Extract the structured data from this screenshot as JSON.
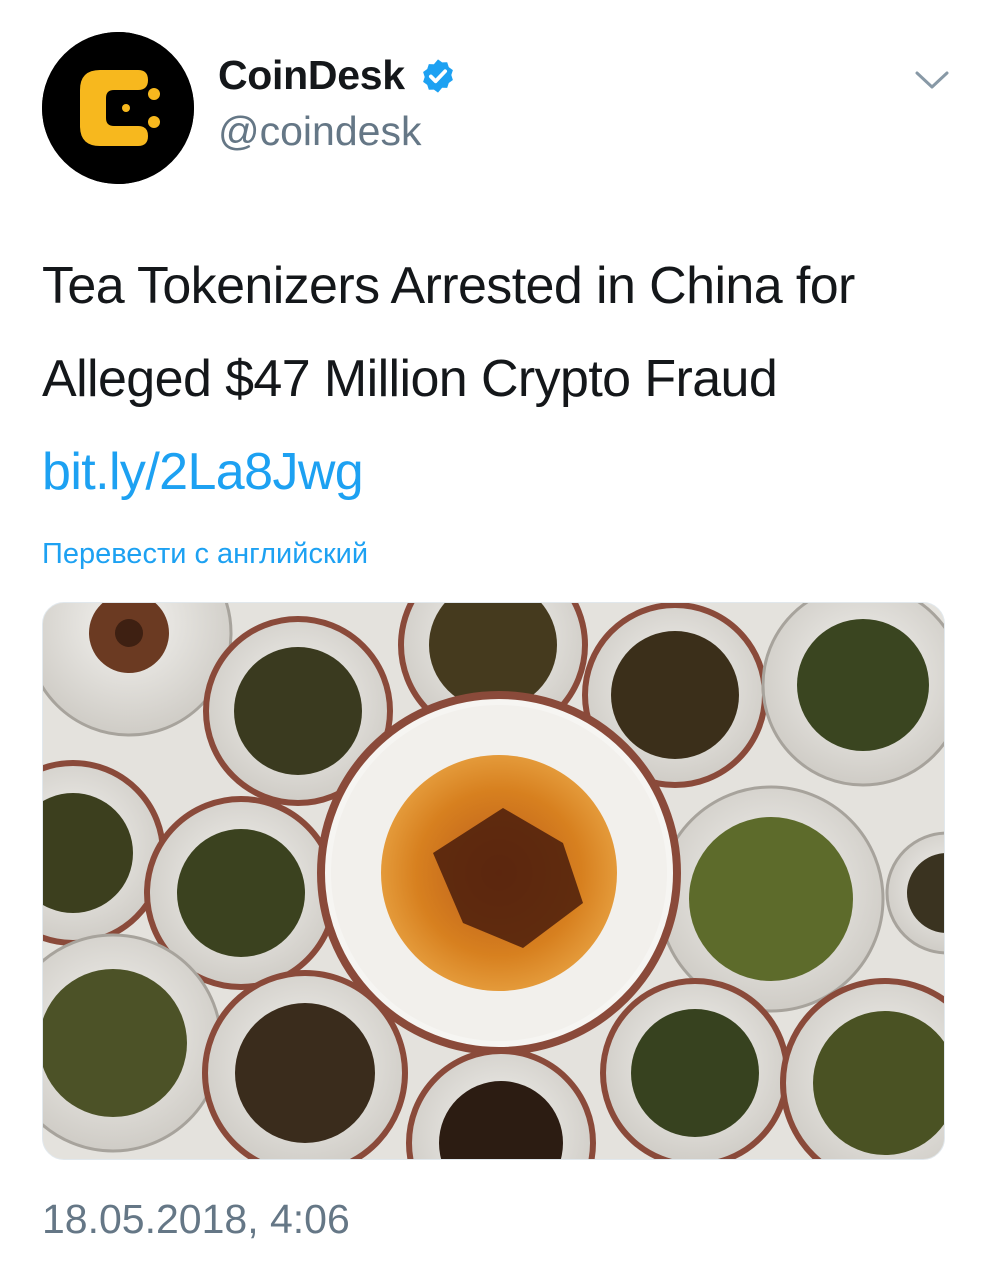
{
  "tweet": {
    "author": {
      "display_name": "CoinDesk",
      "handle": "@coindesk",
      "verified": true,
      "avatar_icon": "coindesk-logo"
    },
    "text": {
      "body": "Tea Tokenizers Arrested in China for Alleged $47 Million Crypto Fraud",
      "link": "bit.ly/2La8Jwg"
    },
    "translate_label": "Перевести с английский",
    "media": {
      "subject": "bowls of loose leaf tea with a cup of brewed tea in the center"
    },
    "timestamp": "18.05.2018, 4:06",
    "menu_icon": "chevron-down-icon"
  },
  "colors": {
    "link": "#1da1f2",
    "secondary_text": "#657786",
    "verified_badge": "#1da1f2",
    "logo_accent": "#f7b81e"
  }
}
